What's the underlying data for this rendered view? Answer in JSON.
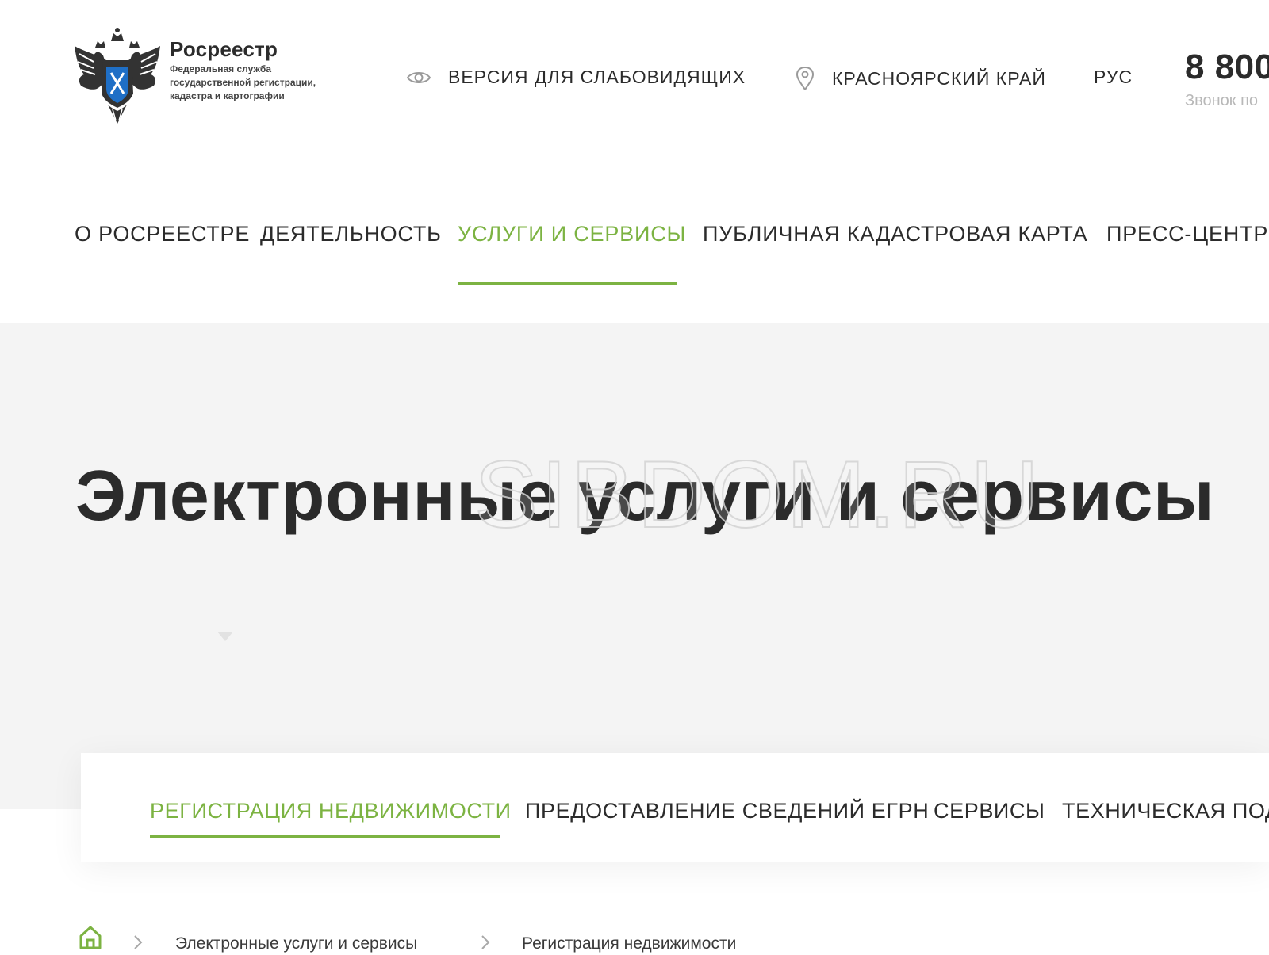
{
  "header": {
    "logo": {
      "title": "Росреестр",
      "subtitle": "Федеральная служба государственной регистрации, кадастра и картографии"
    },
    "low_vision_label": "ВЕРСИЯ ДЛЯ СЛАБОВИДЯЩИХ",
    "region_label": "КРАСНОЯРСКИЙ КРАЙ",
    "language_label": "РУС",
    "phone": "8 800",
    "phone_note": "Звонок по"
  },
  "main_nav": {
    "items": [
      {
        "label": "О РОСРЕЕСТРЕ",
        "active": false
      },
      {
        "label": "ДЕЯТЕЛЬНОСТЬ",
        "active": false
      },
      {
        "label": "УСЛУГИ И СЕРВИСЫ",
        "active": true
      },
      {
        "label": "ПУБЛИЧНАЯ КАДАСТРОВАЯ КАРТА",
        "active": false
      },
      {
        "label": "ПРЕСС-ЦЕНТР",
        "active": false
      }
    ]
  },
  "hero": {
    "title": "Электронные услуги и сервисы",
    "watermark": "SIBDOM.RU"
  },
  "sub_tabs": {
    "items": [
      {
        "label": "РЕГИСТРАЦИЯ НЕДВИЖИМОСТИ",
        "active": true
      },
      {
        "label": "ПРЕДОСТАВЛЕНИЕ СВЕДЕНИЙ ЕГРН",
        "active": false
      },
      {
        "label": "СЕРВИСЫ",
        "active": false
      },
      {
        "label": "ТЕХНИЧЕСКАЯ ПОД",
        "active": false
      }
    ]
  },
  "breadcrumb": {
    "items": [
      {
        "label": "Электронные услуги и сервисы"
      },
      {
        "label": "Регистрация недвижимости"
      }
    ]
  },
  "colors": {
    "accent": "#7cb342",
    "text": "#2b2b2b",
    "hero_background": "#f4f4f4",
    "emblem_shield": "#1f6fc6"
  },
  "icons": {
    "low_vision": "eye-icon",
    "region": "map-pin-icon",
    "home": "home-icon",
    "separator": "chevron-right-icon",
    "logo": "double-headed-eagle-emblem"
  }
}
